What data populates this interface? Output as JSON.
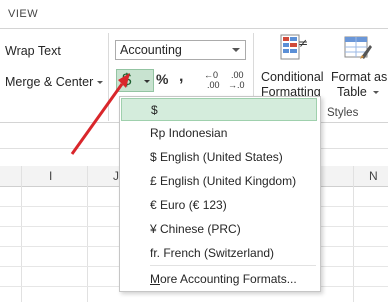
{
  "tabs": {
    "view": "VIEW"
  },
  "ribbon": {
    "wrap_text": "Wrap Text",
    "merge_center": "Merge & Center",
    "number_format_value": "Accounting",
    "accounting_symbol": "$",
    "percent_symbol": "%",
    "comma_symbol": ",",
    "increase_decimal_top": "←0",
    "increase_decimal_bottom": ".00",
    "decrease_decimal_top": ".00",
    "decrease_decimal_bottom": "→.0",
    "conditional_formatting": "Conditional",
    "conditional_formatting_cut": "Formatting",
    "format_as": "Format as",
    "table": "Table",
    "styles_group": "Styles"
  },
  "columns": {
    "i": "I",
    "j": "J",
    "n": "N"
  },
  "menu": {
    "items": [
      "$",
      "Rp Indonesian",
      "$ English (United States)",
      "£ English (United Kingdom)",
      "€ Euro (€ 123)",
      "¥ Chinese (PRC)",
      "fr. French (Switzerland)"
    ],
    "more_prefix": "M",
    "more_rest": "ore Accounting Formats..."
  },
  "colors": {
    "highlight": "#d4ecdc",
    "arrow": "#d9262b",
    "button_active": "#c8e3d0"
  }
}
